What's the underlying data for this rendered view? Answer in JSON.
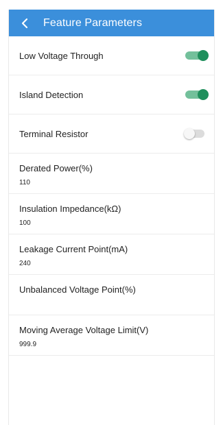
{
  "header": {
    "title": "Feature Parameters",
    "back_icon": "chevron-left-icon"
  },
  "colors": {
    "header": "#3b8fdb",
    "toggle_on_knob": "#1f8f5c",
    "toggle_on_track": "#73c09b",
    "toggle_off_track": "#dcdcdc"
  },
  "toggles": [
    {
      "label": "Low Voltage Through",
      "on": true
    },
    {
      "label": "Island Detection",
      "on": true
    },
    {
      "label": "Terminal Resistor",
      "on": false
    }
  ],
  "params": [
    {
      "label": "Derated Power(%)",
      "value": "110"
    },
    {
      "label": "Insulation Impedance(kΩ)",
      "value": "100"
    },
    {
      "label": "Leakage Current Point(mA)",
      "value": "240"
    },
    {
      "label": "Unbalanced Voltage Point(%)",
      "value": ""
    },
    {
      "label": "Moving Average Voltage Limit(V)",
      "value": "999.9"
    }
  ]
}
